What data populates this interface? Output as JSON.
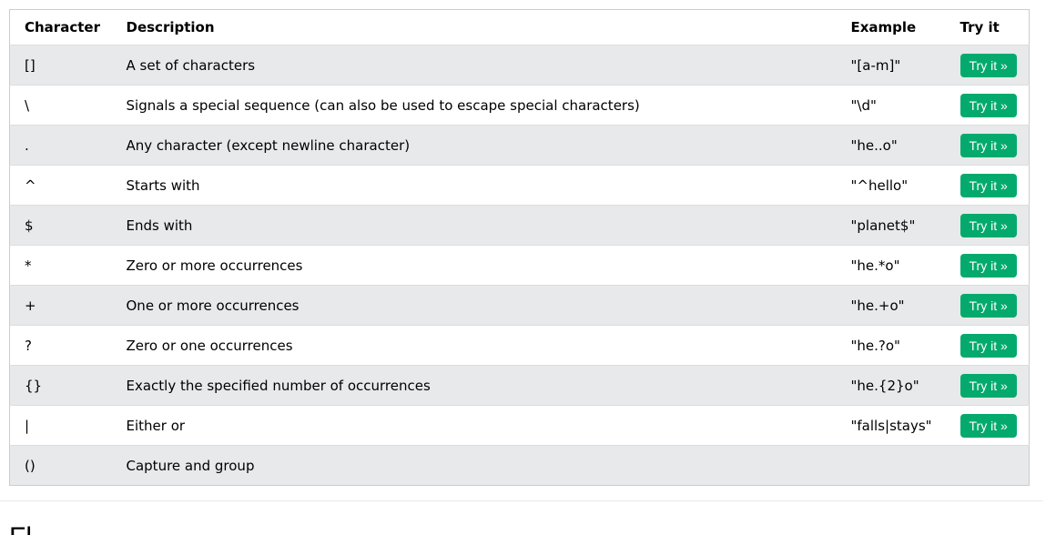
{
  "table": {
    "headers": [
      "Character",
      "Description",
      "Example",
      "Try it"
    ],
    "try_button_label": "Try it »",
    "button_color": "#04aa6d",
    "rows": [
      {
        "character": "[]",
        "description": "A set of characters",
        "example": "\"[a-m]\"",
        "has_try": true
      },
      {
        "character": "\\",
        "description": "Signals a special sequence (can also be used to escape special characters)",
        "example": "\"\\d\"",
        "has_try": true
      },
      {
        "character": ".",
        "description": "Any character (except newline character)",
        "example": "\"he..o\"",
        "has_try": true
      },
      {
        "character": "^",
        "description": "Starts with",
        "example": "\"^hello\"",
        "has_try": true
      },
      {
        "character": "$",
        "description": "Ends with",
        "example": "\"planet$\"",
        "has_try": true
      },
      {
        "character": "*",
        "description": "Zero or more occurrences",
        "example": "\"he.*o\"",
        "has_try": true
      },
      {
        "character": "+",
        "description": "One or more occurrences",
        "example": "\"he.+o\"",
        "has_try": true
      },
      {
        "character": "?",
        "description": "Zero or one occurrences",
        "example": "\"he.?o\"",
        "has_try": true
      },
      {
        "character": "{}",
        "description": "Exactly the specified number of occurrences",
        "example": "\"he.{2}o\"",
        "has_try": true
      },
      {
        "character": "|",
        "description": "Either or",
        "example": "\"falls|stays\"",
        "has_try": true
      },
      {
        "character": "()",
        "description": "Capture and group",
        "example": "",
        "has_try": false
      }
    ]
  },
  "next_heading": "Fl"
}
